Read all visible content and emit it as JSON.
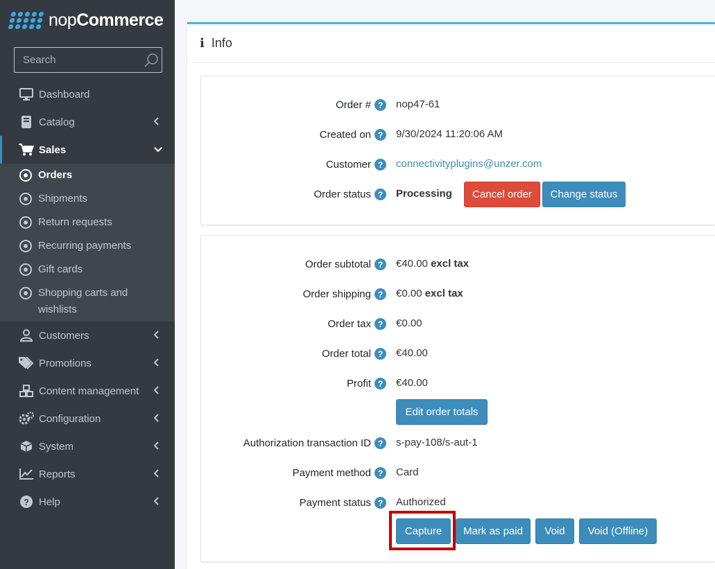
{
  "brand": {
    "name_light": "nop",
    "name_bold": "Commerce"
  },
  "search": {
    "placeholder": "Search"
  },
  "sidebar": {
    "items": [
      {
        "label": "Dashboard",
        "icon": "monitor-icon"
      },
      {
        "label": "Catalog",
        "icon": "book-icon"
      },
      {
        "label": "Sales",
        "icon": "cart-icon"
      },
      {
        "label": "Customers",
        "icon": "user-icon"
      },
      {
        "label": "Promotions",
        "icon": "tags-icon"
      },
      {
        "label": "Content management",
        "icon": "cubes-icon"
      },
      {
        "label": "Configuration",
        "icon": "gears-icon"
      },
      {
        "label": "System",
        "icon": "cube-icon"
      },
      {
        "label": "Reports",
        "icon": "chart-icon"
      },
      {
        "label": "Help",
        "icon": "question-icon"
      }
    ],
    "sales_sub": [
      {
        "label": "Orders"
      },
      {
        "label": "Shipments"
      },
      {
        "label": "Return requests"
      },
      {
        "label": "Recurring payments"
      },
      {
        "label": "Gift cards"
      },
      {
        "label": "Shopping carts and wishlists"
      }
    ]
  },
  "card": {
    "title": "Info"
  },
  "order": {
    "number_label": "Order #",
    "number": "nop47-61",
    "created_label": "Created on",
    "created": "9/30/2024 11:20:06 AM",
    "customer_label": "Customer",
    "customer": "connectivityplugins@unzer.com",
    "status_label": "Order status",
    "status": "Processing",
    "cancel_btn": "Cancel order",
    "change_btn": "Change status"
  },
  "totals": {
    "subtotal_label": "Order subtotal",
    "subtotal": "€40.00",
    "subtotal_suffix": "excl tax",
    "shipping_label": "Order shipping",
    "shipping": "€0.00",
    "shipping_suffix": "excl tax",
    "tax_label": "Order tax",
    "tax": "€0.00",
    "total_label": "Order total",
    "total": "€40.00",
    "profit_label": "Profit",
    "profit": "€40.00",
    "edit_btn": "Edit order totals",
    "auth_label": "Authorization transaction ID",
    "auth": "s-pay-108/s-aut-1",
    "method_label": "Payment method",
    "method": "Card",
    "paystatus_label": "Payment status",
    "paystatus": "Authorized",
    "capture_btn": "Capture",
    "markpaid_btn": "Mark as paid",
    "void_btn": "Void",
    "voidoffline_btn": "Void (Offline)"
  },
  "colors": {
    "sidebar": "#343a40",
    "accent": "#3c8dbc",
    "danger": "#dd4b39",
    "highlight": "#c00000"
  }
}
